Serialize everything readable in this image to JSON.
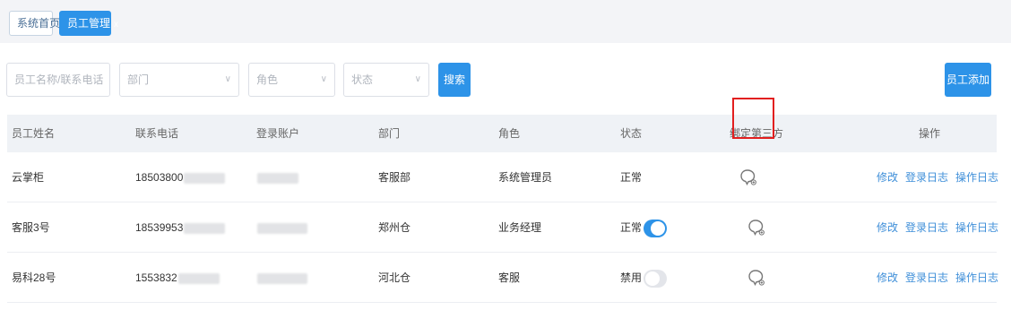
{
  "tabs": {
    "home": "系统首页",
    "active": "员工管理",
    "close": "x"
  },
  "filters": {
    "name_placeholder": "员工名称/联系电话",
    "dept_placeholder": "部门",
    "role_placeholder": "角色",
    "status_placeholder": "状态",
    "arrow": "∨"
  },
  "buttons": {
    "search": "搜索",
    "add": "员工添加"
  },
  "table": {
    "headers": [
      "员工姓名",
      "联系电话",
      "登录账户",
      "部门",
      "角色",
      "状态",
      "绑定第三方",
      "操作"
    ],
    "rows": [
      {
        "name": "云掌柜",
        "phone": "18503800",
        "account": "",
        "dept": "客服部",
        "role": "系统管理员",
        "status": "正常",
        "has_toggle": false
      },
      {
        "name": "客服3号",
        "phone": "18539953",
        "account": "",
        "dept": "郑州仓",
        "role": "业务经理",
        "status": "正常",
        "toggle_on": true
      },
      {
        "name": "易科28号",
        "phone": "1553832",
        "account": "",
        "dept": "河北仓",
        "role": "客服",
        "status": "禁用",
        "toggle_on": false
      }
    ],
    "actions": [
      "修改",
      "登录日志",
      "操作日志"
    ]
  },
  "colors": {
    "primary": "#2d93e8",
    "highlight": "#e21f1f",
    "link": "#3f8fd9"
  },
  "icons": {
    "bind": "wechat-bubble-icon",
    "dropdown": "chevron-down-icon"
  }
}
